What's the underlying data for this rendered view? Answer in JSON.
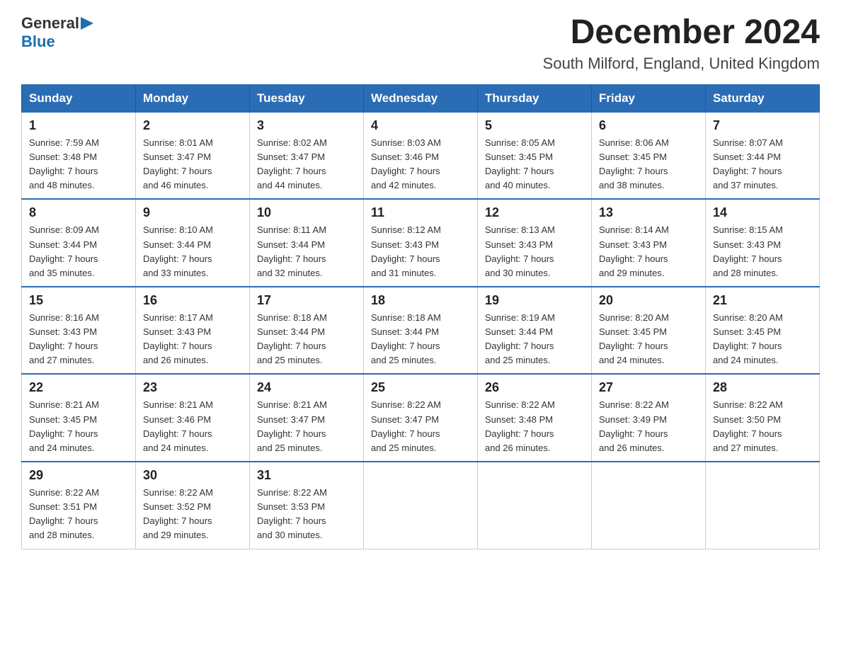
{
  "logo": {
    "text_general": "General",
    "text_blue": "Blue",
    "arrow": "▶"
  },
  "header": {
    "title": "December 2024",
    "subtitle": "South Milford, England, United Kingdom"
  },
  "days_of_week": [
    "Sunday",
    "Monday",
    "Tuesday",
    "Wednesday",
    "Thursday",
    "Friday",
    "Saturday"
  ],
  "weeks": [
    [
      {
        "day": "1",
        "sunrise": "7:59 AM",
        "sunset": "3:48 PM",
        "daylight": "7 hours and 48 minutes."
      },
      {
        "day": "2",
        "sunrise": "8:01 AM",
        "sunset": "3:47 PM",
        "daylight": "7 hours and 46 minutes."
      },
      {
        "day": "3",
        "sunrise": "8:02 AM",
        "sunset": "3:47 PM",
        "daylight": "7 hours and 44 minutes."
      },
      {
        "day": "4",
        "sunrise": "8:03 AM",
        "sunset": "3:46 PM",
        "daylight": "7 hours and 42 minutes."
      },
      {
        "day": "5",
        "sunrise": "8:05 AM",
        "sunset": "3:45 PM",
        "daylight": "7 hours and 40 minutes."
      },
      {
        "day": "6",
        "sunrise": "8:06 AM",
        "sunset": "3:45 PM",
        "daylight": "7 hours and 38 minutes."
      },
      {
        "day": "7",
        "sunrise": "8:07 AM",
        "sunset": "3:44 PM",
        "daylight": "7 hours and 37 minutes."
      }
    ],
    [
      {
        "day": "8",
        "sunrise": "8:09 AM",
        "sunset": "3:44 PM",
        "daylight": "7 hours and 35 minutes."
      },
      {
        "day": "9",
        "sunrise": "8:10 AM",
        "sunset": "3:44 PM",
        "daylight": "7 hours and 33 minutes."
      },
      {
        "day": "10",
        "sunrise": "8:11 AM",
        "sunset": "3:44 PM",
        "daylight": "7 hours and 32 minutes."
      },
      {
        "day": "11",
        "sunrise": "8:12 AM",
        "sunset": "3:43 PM",
        "daylight": "7 hours and 31 minutes."
      },
      {
        "day": "12",
        "sunrise": "8:13 AM",
        "sunset": "3:43 PM",
        "daylight": "7 hours and 30 minutes."
      },
      {
        "day": "13",
        "sunrise": "8:14 AM",
        "sunset": "3:43 PM",
        "daylight": "7 hours and 29 minutes."
      },
      {
        "day": "14",
        "sunrise": "8:15 AM",
        "sunset": "3:43 PM",
        "daylight": "7 hours and 28 minutes."
      }
    ],
    [
      {
        "day": "15",
        "sunrise": "8:16 AM",
        "sunset": "3:43 PM",
        "daylight": "7 hours and 27 minutes."
      },
      {
        "day": "16",
        "sunrise": "8:17 AM",
        "sunset": "3:43 PM",
        "daylight": "7 hours and 26 minutes."
      },
      {
        "day": "17",
        "sunrise": "8:18 AM",
        "sunset": "3:44 PM",
        "daylight": "7 hours and 25 minutes."
      },
      {
        "day": "18",
        "sunrise": "8:18 AM",
        "sunset": "3:44 PM",
        "daylight": "7 hours and 25 minutes."
      },
      {
        "day": "19",
        "sunrise": "8:19 AM",
        "sunset": "3:44 PM",
        "daylight": "7 hours and 25 minutes."
      },
      {
        "day": "20",
        "sunrise": "8:20 AM",
        "sunset": "3:45 PM",
        "daylight": "7 hours and 24 minutes."
      },
      {
        "day": "21",
        "sunrise": "8:20 AM",
        "sunset": "3:45 PM",
        "daylight": "7 hours and 24 minutes."
      }
    ],
    [
      {
        "day": "22",
        "sunrise": "8:21 AM",
        "sunset": "3:45 PM",
        "daylight": "7 hours and 24 minutes."
      },
      {
        "day": "23",
        "sunrise": "8:21 AM",
        "sunset": "3:46 PM",
        "daylight": "7 hours and 24 minutes."
      },
      {
        "day": "24",
        "sunrise": "8:21 AM",
        "sunset": "3:47 PM",
        "daylight": "7 hours and 25 minutes."
      },
      {
        "day": "25",
        "sunrise": "8:22 AM",
        "sunset": "3:47 PM",
        "daylight": "7 hours and 25 minutes."
      },
      {
        "day": "26",
        "sunrise": "8:22 AM",
        "sunset": "3:48 PM",
        "daylight": "7 hours and 26 minutes."
      },
      {
        "day": "27",
        "sunrise": "8:22 AM",
        "sunset": "3:49 PM",
        "daylight": "7 hours and 26 minutes."
      },
      {
        "day": "28",
        "sunrise": "8:22 AM",
        "sunset": "3:50 PM",
        "daylight": "7 hours and 27 minutes."
      }
    ],
    [
      {
        "day": "29",
        "sunrise": "8:22 AM",
        "sunset": "3:51 PM",
        "daylight": "7 hours and 28 minutes."
      },
      {
        "day": "30",
        "sunrise": "8:22 AM",
        "sunset": "3:52 PM",
        "daylight": "7 hours and 29 minutes."
      },
      {
        "day": "31",
        "sunrise": "8:22 AM",
        "sunset": "3:53 PM",
        "daylight": "7 hours and 30 minutes."
      },
      null,
      null,
      null,
      null
    ]
  ],
  "labels": {
    "sunrise": "Sunrise:",
    "sunset": "Sunset:",
    "daylight": "Daylight:"
  }
}
